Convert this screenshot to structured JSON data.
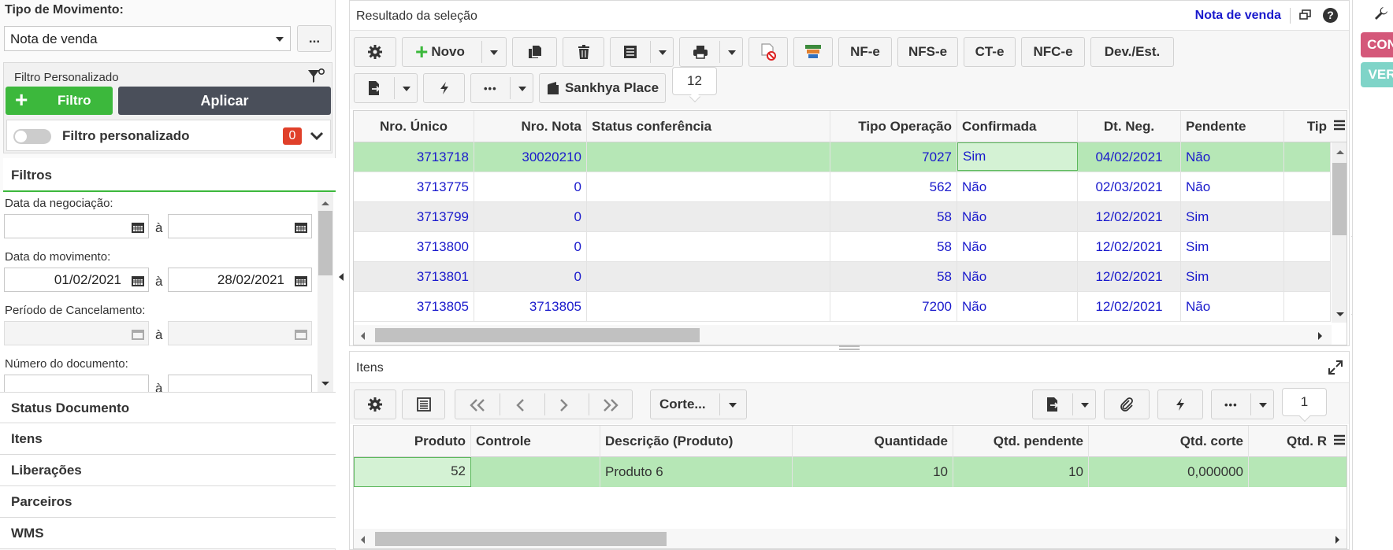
{
  "movement": {
    "label": "Tipo de Movimento:",
    "value": "Nota de venda",
    "more_label": "..."
  },
  "custom_filter": {
    "title": "Filtro Personalizado",
    "add_label": "Filtro",
    "apply_label": "Aplicar",
    "toggle_label": "Filtro personalizado",
    "count": "0"
  },
  "filters": {
    "header": "Filtros",
    "neg_date_label": "Data da negociação:",
    "mov_date_label": "Data do movimento:",
    "mov_date_from": "01/02/2021",
    "mov_date_to": "28/02/2021",
    "cancel_label": "Período de Cancelamento:",
    "doc_number_label": "Número do documento:",
    "range_sep": "à",
    "sections": [
      "Status Documento",
      "Itens",
      "Liberações",
      "Parceiros",
      "WMS"
    ]
  },
  "results": {
    "title": "Resultado da seleção",
    "context_label": "Nota de venda",
    "help_symbol": "?",
    "toolbar": {
      "new_label": "Novo",
      "nfe": "NF-e",
      "nfse": "NFS-e",
      "cte": "CT-e",
      "nfce": "NFC-e",
      "dev": "Dev./Est.",
      "place": "Sankhya Place",
      "more_symbol": "•••",
      "count": "12"
    },
    "columns": [
      "Nro. Único",
      "Nro. Nota",
      "Status conferência",
      "Tipo Operação",
      "Confirmada",
      "Dt. Neg.",
      "Pendente",
      "Tip"
    ],
    "rows": [
      {
        "unico": "3713718",
        "nota": "30020210",
        "status": "",
        "tipo": "7027",
        "confirmada": "Sim",
        "dt": "04/02/2021",
        "pendente": "Não"
      },
      {
        "unico": "3713775",
        "nota": "0",
        "status": "",
        "tipo": "562",
        "confirmada": "Não",
        "dt": "02/03/2021",
        "pendente": "Não"
      },
      {
        "unico": "3713799",
        "nota": "0",
        "status": "",
        "tipo": "58",
        "confirmada": "Não",
        "dt": "12/02/2021",
        "pendente": "Sim"
      },
      {
        "unico": "3713800",
        "nota": "0",
        "status": "",
        "tipo": "58",
        "confirmada": "Não",
        "dt": "12/02/2021",
        "pendente": "Sim"
      },
      {
        "unico": "3713801",
        "nota": "0",
        "status": "",
        "tipo": "58",
        "confirmada": "Não",
        "dt": "12/02/2021",
        "pendente": "Sim"
      },
      {
        "unico": "3713805",
        "nota": "3713805",
        "status": "",
        "tipo": "7200",
        "confirmada": "Não",
        "dt": "12/02/2021",
        "pendente": "Não"
      }
    ]
  },
  "items": {
    "title": "Itens",
    "corte_label": "Corte...",
    "count": "1",
    "more_symbol": "•••",
    "columns": [
      "Produto",
      "Controle",
      "Descrição (Produto)",
      "Quantidade",
      "Qtd. pendente",
      "Qtd. corte",
      "Qtd. R"
    ],
    "rows": [
      {
        "produto": "52",
        "controle": "",
        "descricao": "Produto 6",
        "quantidade": "10",
        "pendente": "10",
        "corte": "0,000000"
      }
    ]
  },
  "right_bar": {
    "con": "CON",
    "ver": "VER"
  },
  "colors": {
    "selected_row": "#b6e7b6",
    "link_blue": "#1a1acc",
    "add_green": "#3cb83c",
    "apply_dark": "#4a4f5a",
    "badge_red": "#e0402a",
    "con_pink": "#d4587a",
    "ver_teal": "#7fd4c8"
  }
}
